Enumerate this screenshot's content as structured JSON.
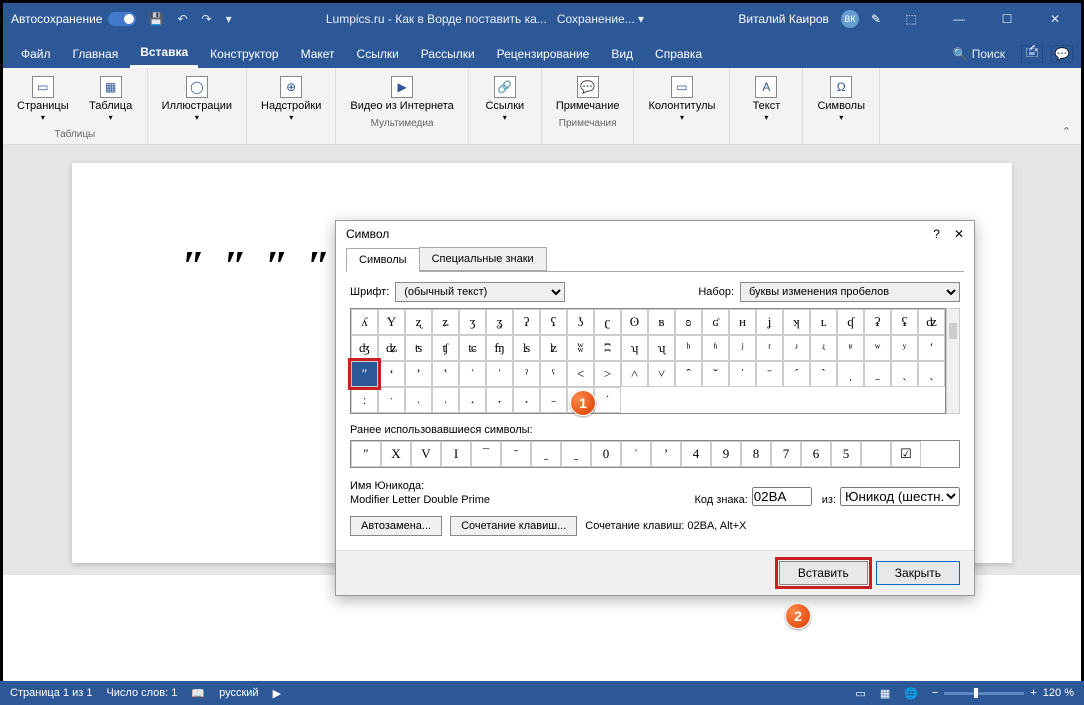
{
  "titlebar": {
    "autosave": "Автосохранение",
    "title": "Lumpics.ru - Как в Ворде поставить ка...",
    "saving": "Сохранение... ▾",
    "user": "Виталий Каиров",
    "initials": "ВК"
  },
  "menu": {
    "file": "Файл",
    "home": "Главная",
    "insert": "Вставка",
    "design": "Конструктор",
    "layout": "Макет",
    "references": "Ссылки",
    "mailings": "Рассылки",
    "review": "Рецензирование",
    "view": "Вид",
    "help": "Справка",
    "search": "Поиск"
  },
  "ribbon": {
    "pages": "Страницы",
    "table": "Таблица",
    "tables_group": "Таблицы",
    "illustrations": "Иллюстрации",
    "addins": "Надстройки",
    "video": "Видео из Интернета",
    "media_group": "Мультимедиа",
    "links": "Ссылки",
    "comment": "Примечание",
    "comments_group": "Примечания",
    "headers": "Колонтитулы",
    "text": "Текст",
    "symbols": "Символы"
  },
  "doc_text": "″ ″   ″ ″",
  "dialog": {
    "title": "Символ",
    "tab_symbols": "Символы",
    "tab_special": "Специальные знаки",
    "font_label": "Шрифт:",
    "font_value": "(обычный текст)",
    "subset_label": "Набор:",
    "subset_value": "буквы изменения пробелов",
    "recent_label": "Ранее использовавшиеся символы:",
    "unicode_label": "Имя Юникода:",
    "unicode_name": "Modifier Letter Double Prime",
    "code_label": "Код знака:",
    "code_value": "02BA",
    "from_label": "из:",
    "from_value": "Юникод (шестн.)",
    "autocorrect": "Автозамена...",
    "shortcut_btn": "Сочетание клавиш...",
    "shortcut_text": "Сочетание клавиш: 02BA, Alt+X",
    "insert": "Вставить",
    "close": "Закрыть",
    "grid": [
      [
        "ʎ",
        "Y",
        "ʐ",
        "ʑ",
        "ʒ",
        "ʓ",
        "ʔ",
        "ʕ",
        "ʖ",
        "ʗ",
        "ʘ",
        "ʙ",
        "ʚ",
        "ʛ",
        "ʜ",
        "ʝ",
        "ʞ",
        "ʟ",
        "ʠ"
      ],
      [
        "ʡ",
        "ʢ",
        "ʣ",
        "ʤ",
        "ʥ",
        "ʦ",
        "ʧ",
        "ʨ",
        "ʩ",
        "ʪ",
        "ʫ",
        "ʬ",
        "ʭ",
        "ʮ",
        "ʯ",
        "ʰ",
        "ʱ",
        "ʲ",
        "ʳ"
      ],
      [
        "ʴ",
        "ʵ",
        "ʶ",
        "ʷ",
        "ʸ",
        "ʹ",
        "″",
        "ʻ",
        "ʼ",
        "ʽ",
        "ʾ",
        "ʿ",
        "ˀ",
        "ˁ",
        "˂",
        "˃",
        "˄",
        "˅",
        "ˆ"
      ],
      [
        "ˇ",
        "ˈ",
        "ˉ",
        "ˊ",
        "ˋ",
        "ˌ",
        "ˍ",
        "ˎ",
        "ˏ",
        "ː",
        "ˑ",
        "˒",
        "˓",
        "˔",
        "˕",
        "˖",
        "˗",
        "˘",
        "˙"
      ]
    ],
    "recent": [
      "″",
      "X",
      "V",
      "I",
      "¯",
      "ˉ",
      "ˍ",
      "ˍ",
      "0",
      "ʿ",
      "ʼ",
      "4",
      "9",
      "8",
      "7",
      "6",
      "5",
      "",
      "☑"
    ]
  },
  "status": {
    "page": "Страница 1 из 1",
    "words": "Число слов: 1",
    "lang": "русский",
    "zoom": "120 %"
  },
  "markers": {
    "m1": "1",
    "m2": "2"
  }
}
